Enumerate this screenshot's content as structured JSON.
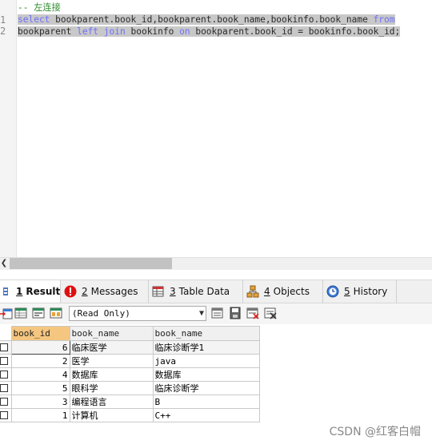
{
  "editor": {
    "comment": "-- 左连接",
    "line1": [
      {
        "t": "select",
        "c": "kw"
      },
      {
        "t": " bookparent.book_id,bookparent.book_name,bookinfo.book_name ",
        "c": "tx"
      },
      {
        "t": "from",
        "c": "kw"
      }
    ],
    "line2": [
      {
        "t": "bookparent ",
        "c": "tx"
      },
      {
        "t": "left",
        "c": "kw"
      },
      {
        "t": " ",
        "c": "tx"
      },
      {
        "t": "join",
        "c": "kw"
      },
      {
        "t": " bookinfo ",
        "c": "tx"
      },
      {
        "t": "on",
        "c": "kw"
      },
      {
        "t": " bookparent.book_id = bookinfo.book_id;",
        "c": "tx"
      }
    ],
    "gutter": [
      "1",
      "2"
    ]
  },
  "tabs": {
    "result": {
      "num": "1",
      "label": "Result"
    },
    "messages": {
      "num": "2",
      "label": "Messages"
    },
    "table_data": {
      "num": "3",
      "label": "Table Data"
    },
    "objects": {
      "num": "4",
      "label": "Objects"
    },
    "history": {
      "num": "5",
      "label": "History"
    }
  },
  "toolbar": {
    "mode": "(Read Only)"
  },
  "grid": {
    "columns": [
      "book_id",
      "book_name",
      "book_name"
    ],
    "rows": [
      [
        "6",
        "临床医学",
        "临床诊断学1"
      ],
      [
        "2",
        "医学",
        "java"
      ],
      [
        "4",
        "数据库",
        "数据库"
      ],
      [
        "5",
        "眼科学",
        "临床诊断学"
      ],
      [
        "3",
        "编程语言",
        "B"
      ],
      [
        "1",
        "计算机",
        "C++"
      ]
    ]
  },
  "watermark": "CSDN @红客白帽",
  "colors": {
    "keyword": "#6e6eff",
    "comment": "#2c8a2c",
    "selection": "#c8c8c8",
    "sorted_header": "#f5c680"
  }
}
